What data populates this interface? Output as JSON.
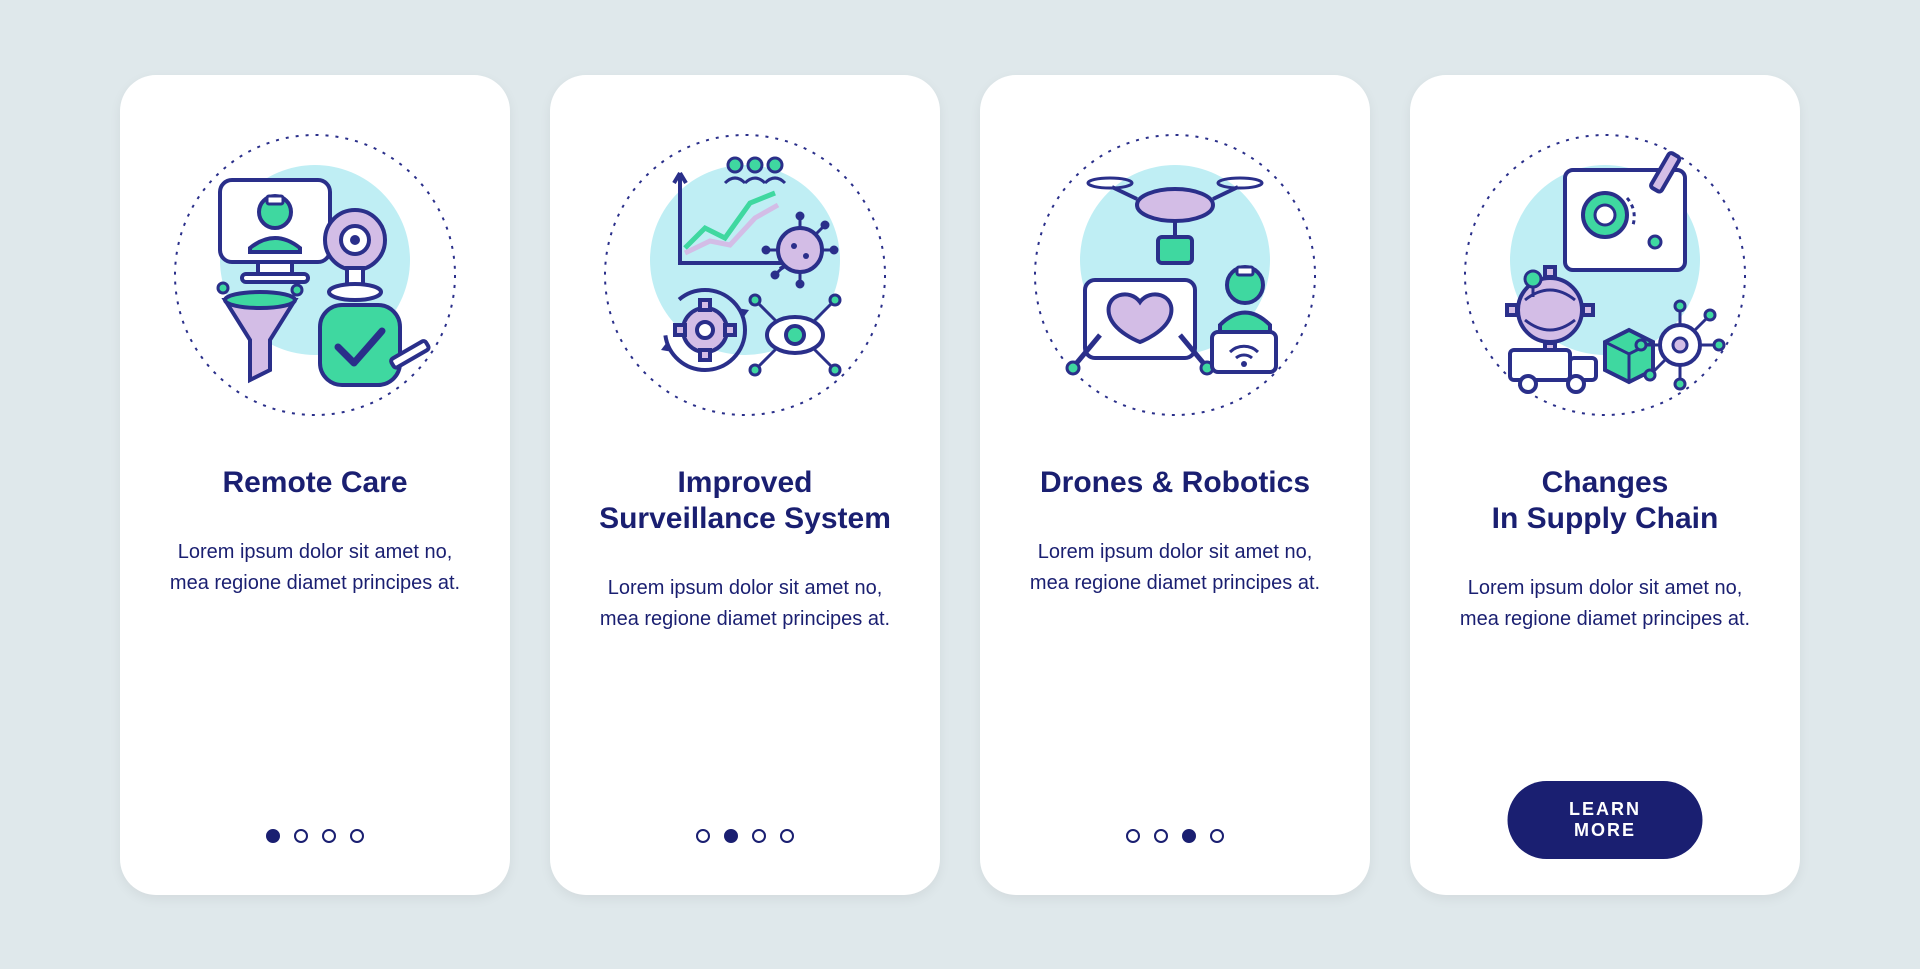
{
  "colors": {
    "navy": "#1a1f71",
    "green": "#3fd8a0",
    "lilac": "#d3bde6",
    "cyan": "#bfeef4",
    "stroke": "#2a2f8a"
  },
  "cards": [
    {
      "icon": "remote-care-icon",
      "title": "Remote Care",
      "desc": "Lorem ipsum dolor sit amet no, mea regione diamet principes at.",
      "active_dot": 0,
      "has_button": false
    },
    {
      "icon": "surveillance-icon",
      "title": "Improved\nSurveillance System",
      "desc": "Lorem ipsum dolor sit amet no, mea regione diamet principes at.",
      "active_dot": 1,
      "has_button": false
    },
    {
      "icon": "drones-robotics-icon",
      "title": "Drones & Robotics",
      "desc": "Lorem ipsum dolor sit amet no, mea regione diamet principes at.",
      "active_dot": 2,
      "has_button": false
    },
    {
      "icon": "supply-chain-icon",
      "title": "Changes\nIn Supply Chain",
      "desc": "Lorem ipsum dolor sit amet no, mea regione diamet principes at.",
      "active_dot": 3,
      "has_button": true
    }
  ],
  "button_label": "LEARN MORE",
  "dot_count": 4
}
